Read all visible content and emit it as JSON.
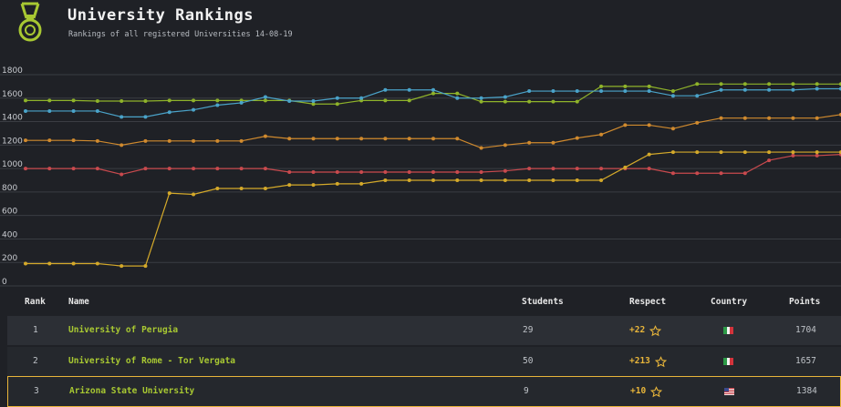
{
  "header": {
    "title": "University Rankings",
    "subtitle": "Rankings of all registered Universities 14-08-19"
  },
  "colors": {
    "background": "#1f2126",
    "accent_green": "#a8c832",
    "accent_gold": "#e8b53a",
    "grid": "#3a3d43"
  },
  "chart_data": {
    "type": "line",
    "yticks": [
      "0",
      "200",
      "400",
      "600",
      "800",
      "1000",
      "1200",
      "1400",
      "1600",
      "1800"
    ],
    "ylim": [
      0,
      1800
    ],
    "grid": true,
    "series": [
      {
        "color": "#8fb32a",
        "values": [
          1580,
          1580,
          1580,
          1575,
          1575,
          1575,
          1580,
          1580,
          1580,
          1580,
          1580,
          1580,
          1550,
          1550,
          1580,
          1580,
          1580,
          1640,
          1640,
          1570,
          1570,
          1570,
          1570,
          1570,
          1700,
          1700,
          1700,
          1660,
          1720,
          1720,
          1720,
          1720,
          1720,
          1720,
          1720
        ]
      },
      {
        "color": "#4aa3c9",
        "values": [
          1490,
          1490,
          1490,
          1490,
          1440,
          1440,
          1480,
          1500,
          1540,
          1560,
          1610,
          1575,
          1575,
          1600,
          1600,
          1670,
          1670,
          1670,
          1600,
          1600,
          1610,
          1660,
          1660,
          1660,
          1660,
          1660,
          1660,
          1620,
          1620,
          1670,
          1670,
          1670,
          1670,
          1680,
          1680
        ]
      },
      {
        "color": "#d08a2e",
        "values": [
          1240,
          1240,
          1240,
          1235,
          1200,
          1235,
          1235,
          1235,
          1235,
          1235,
          1275,
          1255,
          1255,
          1255,
          1255,
          1255,
          1255,
          1255,
          1255,
          1175,
          1200,
          1220,
          1220,
          1260,
          1290,
          1370,
          1370,
          1340,
          1390,
          1430,
          1430,
          1430,
          1430,
          1430,
          1460
        ]
      },
      {
        "color": "#c94a4e",
        "values": [
          1000,
          1000,
          1000,
          1000,
          950,
          1000,
          1000,
          1000,
          1000,
          1000,
          1000,
          970,
          970,
          970,
          970,
          970,
          970,
          970,
          970,
          970,
          980,
          1000,
          1000,
          1000,
          1000,
          1000,
          1000,
          960,
          960,
          960,
          960,
          1070,
          1110,
          1110,
          1120
        ]
      },
      {
        "color": "#d4a92a",
        "values": [
          190,
          190,
          190,
          190,
          170,
          170,
          790,
          780,
          830,
          830,
          830,
          860,
          860,
          870,
          870,
          900,
          900,
          900,
          900,
          900,
          900,
          900,
          900,
          900,
          900,
          1010,
          1120,
          1140,
          1140,
          1140,
          1140,
          1140,
          1140,
          1140,
          1140
        ]
      }
    ]
  },
  "table": {
    "headers": {
      "rank": "Rank",
      "name": "Name",
      "students": "Students",
      "respect": "Respect",
      "country": "Country",
      "points": "Points"
    },
    "rows": [
      {
        "rank": "1",
        "name": "University of Perugia",
        "students": "29",
        "respect": "+22",
        "country_flag": "italy-flag-icon",
        "points": "1704"
      },
      {
        "rank": "2",
        "name": "University of Rome - Tor Vergata",
        "students": "50",
        "respect": "+213",
        "country_flag": "italy-flag-icon",
        "points": "1657"
      },
      {
        "rank": "3",
        "name": "Arizona State University",
        "students": "9",
        "respect": "+10",
        "country_flag": "usa-flag-icon",
        "points": "1384"
      }
    ]
  }
}
